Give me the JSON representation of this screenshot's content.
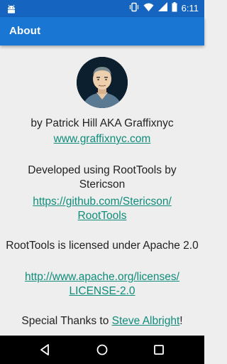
{
  "status_bar": {
    "time": "6:11"
  },
  "app_bar": {
    "title": "About"
  },
  "about": {
    "author_text": "by Patrick Hill AKA Graffixnyc",
    "author_link": "www.graffixnyc.com",
    "developed_text": "Developed using RootTools by Stericson",
    "github_link_line1": "https://github.com/Stericson/",
    "github_link_line2": "RootTools",
    "license_text": "RootTools is licensed under Apache 2.0",
    "license_link_line1": "http://www.apache.org/licenses/",
    "license_link_line2": "LICENSE-2.0",
    "thanks_prefix": "Special Thanks to ",
    "thanks_name": "Steve Albright",
    "thanks_suffix": "!"
  },
  "colors": {
    "status_bar": "#1565c0",
    "app_bar": "#1976d2",
    "link": "#0f8c7a",
    "background": "#eeeeee"
  },
  "icons": [
    "android-icon",
    "vibrate-icon",
    "wifi-icon",
    "signal-icon",
    "battery-icon",
    "back-icon",
    "home-icon",
    "recents-icon"
  ]
}
